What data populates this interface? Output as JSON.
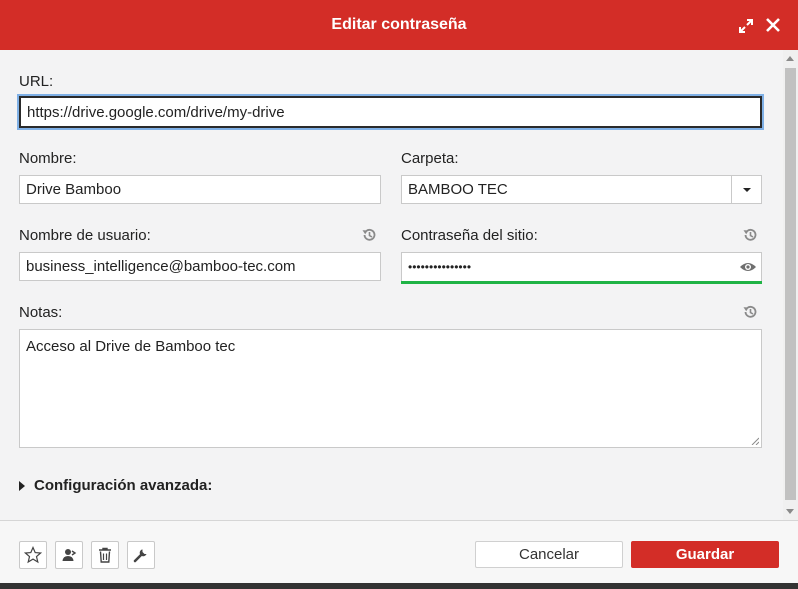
{
  "dialog": {
    "title": "Editar contraseña"
  },
  "fields": {
    "url_label": "URL:",
    "url_value": "https://drive.google.com/drive/my-drive",
    "name_label": "Nombre:",
    "name_value": "Drive Bamboo",
    "folder_label": "Carpeta:",
    "folder_value": "BAMBOO TEC",
    "username_label": "Nombre de usuario:",
    "username_value": "business_intelligence@bamboo-tec.com",
    "password_label": "Contraseña del sitio:",
    "password_value": "•••••••••••••••",
    "password_strength_color": "#1fb345",
    "notes_label": "Notas:",
    "notes_value": "Acceso al Drive de Bamboo tec"
  },
  "advanced": {
    "label": "Configuración avanzada:"
  },
  "footer": {
    "cancel_label": "Cancelar",
    "save_label": "Guardar"
  },
  "icons": {
    "expand": "expand-icon",
    "close": "close-icon",
    "history": "history-icon",
    "eye": "eye-icon",
    "favorite": "star-icon",
    "share": "share-user-icon",
    "delete": "trash-icon",
    "tools": "wrench-icon"
  },
  "colors": {
    "accent": "#d32d27"
  }
}
